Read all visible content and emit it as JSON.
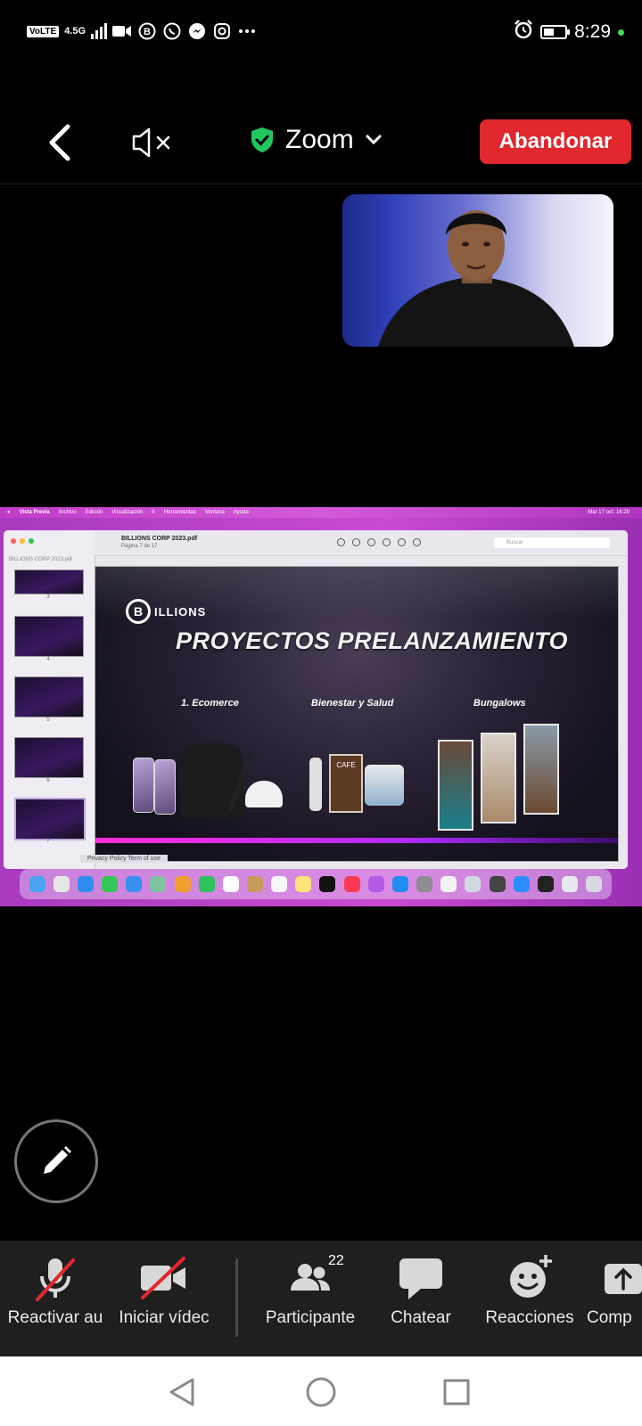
{
  "status_bar": {
    "volte": "VoLTE",
    "network": "4.5G",
    "time": "8:29",
    "battery_level": 0.5,
    "icons": [
      "video-icon",
      "b-icon",
      "whatsapp-icon",
      "messenger-icon",
      "instagram-icon",
      "more-dots-icon",
      "alarm-icon",
      "battery-icon"
    ]
  },
  "top_bar": {
    "title": "Zoom",
    "leave_label": "Abandonar",
    "leave_color": "#e0282e",
    "shield_color": "#22c55e"
  },
  "shared_screen": {
    "menubar": [
      "Vista Previa",
      "Archivo",
      "Edición",
      "Visualización",
      "Ir",
      "Herramientas",
      "Ventana",
      "Ayuda"
    ],
    "menubar_right": "Mar 17 oct. 16:29",
    "sidebar_file": "BILLIONS CORP 2023.pdf",
    "thumb_pages": [
      "3",
      "4",
      "5",
      "6",
      "7"
    ],
    "filename": "BILLIONS CORP 2023.pdf",
    "page_info": "Página 7 de 17",
    "search_placeholder": "Buscar",
    "slide": {
      "logo": "ILLIONS",
      "title": "PROYECTOS PRELANZAMIENTO",
      "categories": [
        "1. Ecomerce",
        "Bienestar y Salud",
        "Bungalows"
      ],
      "coffee_label": "CAFE"
    },
    "privacy": "Privacy Policy   Term of use"
  },
  "toolbar": {
    "items": [
      {
        "label": "Reactivar au",
        "icon": "mic-muted-icon"
      },
      {
        "label": "Iniciar vídec",
        "icon": "video-off-icon"
      },
      {
        "label": "Participante",
        "icon": "participants-icon",
        "badge": "22"
      },
      {
        "label": "Chatear",
        "icon": "chat-icon"
      },
      {
        "label": "Reacciones",
        "icon": "reactions-icon"
      },
      {
        "label": "Comp",
        "icon": "share-icon"
      }
    ]
  },
  "nav": {
    "icons": [
      "back-triangle-icon",
      "home-circle-icon",
      "recents-square-icon"
    ]
  }
}
